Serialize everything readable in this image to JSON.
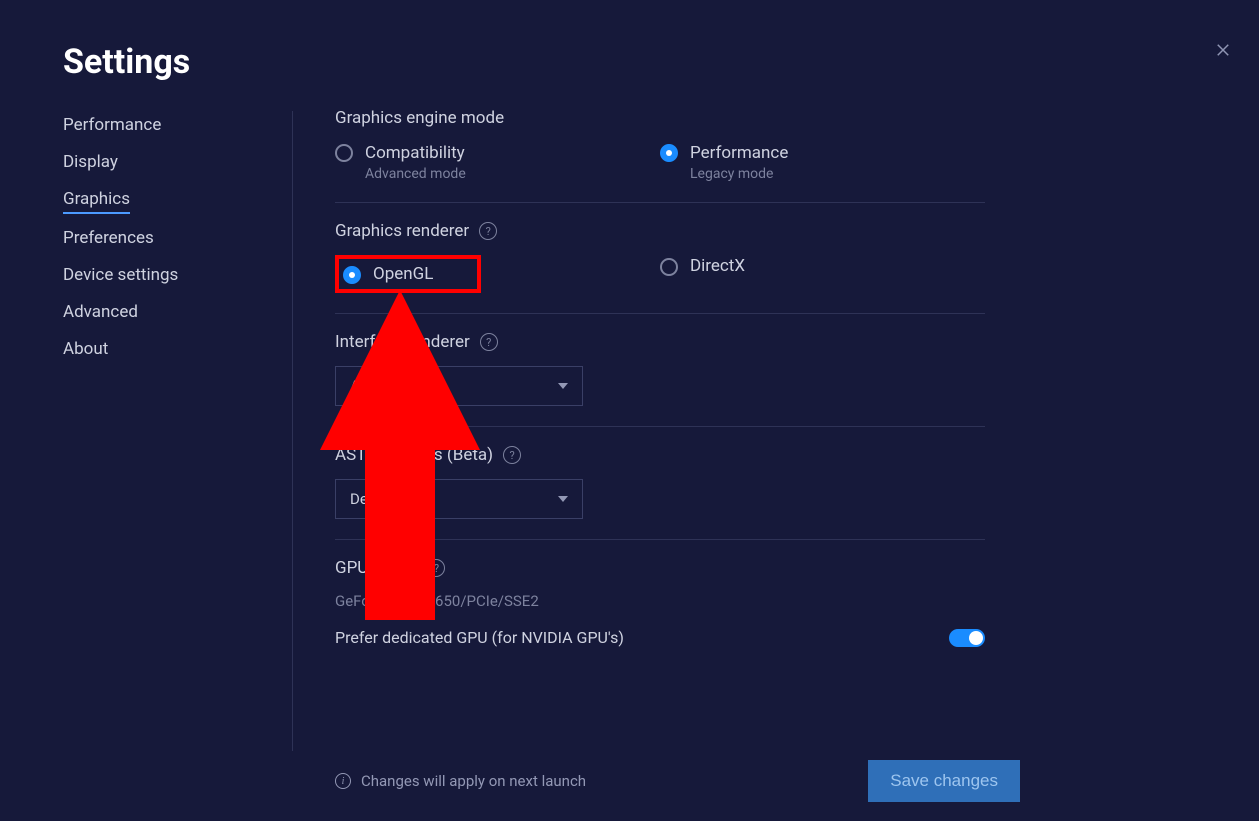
{
  "title": "Settings",
  "sidebar": {
    "items": [
      {
        "label": "Performance",
        "active": false
      },
      {
        "label": "Display",
        "active": false
      },
      {
        "label": "Graphics",
        "active": true
      },
      {
        "label": "Preferences",
        "active": false
      },
      {
        "label": "Device settings",
        "active": false
      },
      {
        "label": "Advanced",
        "active": false
      },
      {
        "label": "About",
        "active": false
      }
    ]
  },
  "sections": {
    "engine": {
      "title": "Graphics engine mode",
      "options": [
        {
          "label": "Compatibility",
          "sub": "Advanced mode",
          "selected": false
        },
        {
          "label": "Performance",
          "sub": "Legacy mode",
          "selected": true
        }
      ]
    },
    "renderer": {
      "title": "Graphics renderer",
      "options": [
        {
          "label": "OpenGL",
          "selected": true
        },
        {
          "label": "DirectX",
          "selected": false
        }
      ]
    },
    "interface": {
      "title": "Interface renderer",
      "value": "Auto"
    },
    "astc": {
      "title": "ASTC textures (Beta)",
      "value": "Default"
    },
    "gpu": {
      "title": "GPU in use",
      "value": "GeForce GTX 1650/PCIe/SSE2",
      "prefer_label": "Prefer dedicated GPU (for NVIDIA GPU's)",
      "prefer_on": true
    }
  },
  "footer": {
    "note": "Changes will apply on next launch",
    "save": "Save changes"
  }
}
